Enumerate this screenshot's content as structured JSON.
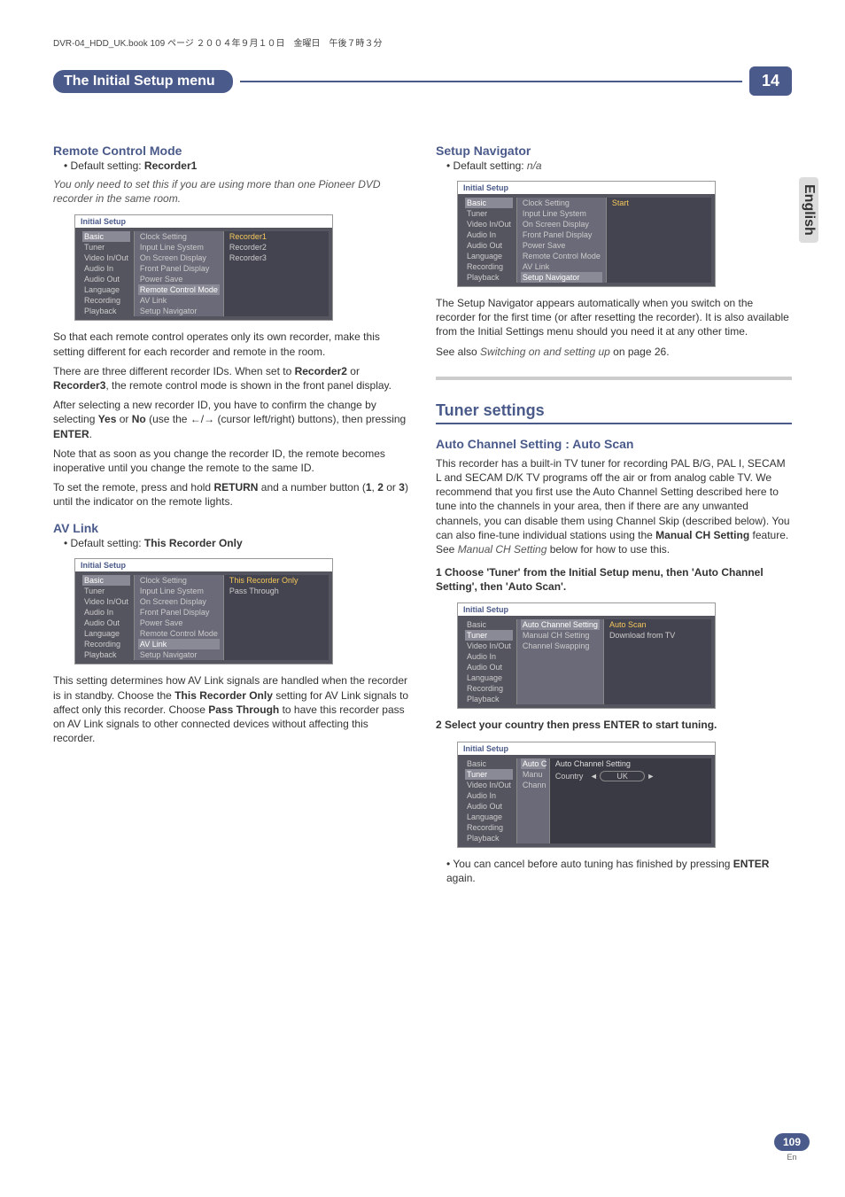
{
  "header": "DVR-04_HDD_UK.book  109 ページ  ２００４年９月１０日　金曜日　午後７時３分",
  "title": "The Initial Setup menu",
  "chapter": "14",
  "sideTab": "English",
  "pageNum": "109",
  "pageLang": "En",
  "left": {
    "h1": "Remote Control Mode",
    "default1_label": "• Default setting: ",
    "default1_val": "Recorder1",
    "intro1": "You only need to set this if you are using more than one Pioneer DVD recorder in the same room.",
    "p1": "So that each remote control operates only its own recorder, make this setting different for each recorder and remote in the room.",
    "p2a": "There are three different recorder IDs. When set to ",
    "p2b": "Recorder2",
    "p2c": " or ",
    "p2d": "Recorder3",
    "p2e": ", the remote control mode is shown in the front panel display.",
    "p3a": "After selecting a new recorder ID, you have to confirm the change by selecting ",
    "p3b": "Yes",
    "p3c": " or ",
    "p3d": "No",
    "p3e": " (use the ",
    "p3f": " (cursor left/right) buttons), then pressing ",
    "p3g": "ENTER",
    "p3h": ".",
    "p4": "Note that as soon as you change the recorder ID, the remote becomes inoperative until you change the remote to the same ID.",
    "p5a": "To set the remote, press and hold ",
    "p5b": "RETURN",
    "p5c": " and a number button (",
    "p5d": "1",
    "p5e": ", ",
    "p5f": "2",
    "p5g": " or ",
    "p5h": "3",
    "p5i": ") until the indicator on the remote lights.",
    "h2": "AV Link",
    "default2_label": "• Default setting: ",
    "default2_val": "This Recorder Only",
    "p6a": "This setting determines how AV Link signals are handled when the recorder is in standby. Choose the ",
    "p6b": "This Recorder Only",
    "p6c": " setting for AV Link signals to affect only this recorder. Choose ",
    "p6d": "Pass Through",
    "p6e": " to have this recorder pass on AV Link signals to other connected devices without affecting this recorder."
  },
  "right": {
    "h1": "Setup Navigator",
    "default_label": "• Default setting: ",
    "default_val": "n/a",
    "p1": "The Setup Navigator appears automatically when you switch on the recorder for the first time (or after resetting the recorder). It is also available from the Initial Settings menu should you need it at any other time.",
    "p2a": "See also ",
    "p2b": "Switching on and setting up",
    "p2c": " on page 26.",
    "major": "Tuner settings",
    "h2": "Auto Channel Setting : Auto Scan",
    "p3a": "This recorder has a built-in TV tuner for recording PAL B/G, PAL I, SECAM L and SECAM D/K TV programs off the air or from analog cable TV. We recommend that you first use the Auto Channel Setting described here to tune into the channels in your area, then if there are any unwanted channels, you can disable them using Channel Skip (described below). You can also fine-tune individual stations using the ",
    "p3b": "Manual CH Setting",
    "p3c": " feature. See ",
    "p3d": "Manual CH Setting",
    "p3e": " below for how to use this.",
    "step1": "1    Choose 'Tuner' from the Initial Setup menu, then 'Auto Channel Setting', then 'Auto Scan'.",
    "step2": "2    Select your country then press ENTER to start tuning.",
    "note_a": "• You can cancel before auto tuning has finished by pressing ",
    "note_b": "ENTER",
    "note_c": " again."
  },
  "menu": {
    "title": "Initial Setup",
    "cats": [
      "Basic",
      "Tuner",
      "Video In/Out",
      "Audio In",
      "Audio Out",
      "Language",
      "Recording",
      "Playback"
    ],
    "basicItems": [
      "Clock Setting",
      "Input Line System",
      "On Screen Display",
      "Front Panel Display",
      "Power Save",
      "Remote Control Mode",
      "AV Link",
      "Setup Navigator"
    ],
    "rcOptions": [
      "Recorder1",
      "Recorder2",
      "Recorder3"
    ],
    "avOptions": [
      "This Recorder Only",
      "Pass Through"
    ],
    "navOption": "Start",
    "tunerItems": [
      "Auto Channel Setting",
      "Manual CH Setting",
      "Channel Swapping"
    ],
    "tunerOptions": [
      "Auto Scan",
      "Download from TV"
    ],
    "autoTitle": "Auto Channel Setting",
    "countryLabel": "Country",
    "countryVal": "UK",
    "tunerShort": [
      "Auto C",
      "Manu",
      "Chann"
    ]
  }
}
